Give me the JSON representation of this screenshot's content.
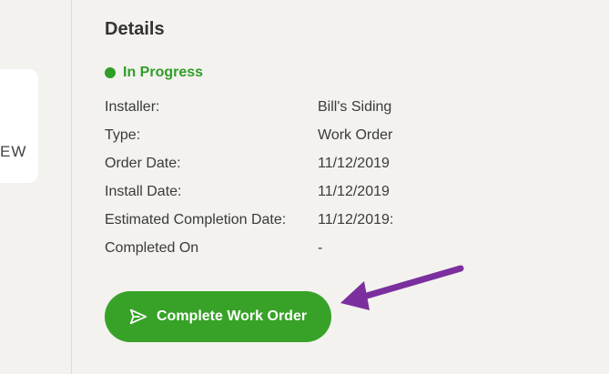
{
  "left_panel": {
    "partial_text": "EW"
  },
  "details": {
    "heading": "Details",
    "status": {
      "label": "In Progress",
      "color": "#2e9e26"
    },
    "rows": [
      {
        "label": "Installer:",
        "value": "Bill's Siding"
      },
      {
        "label": "Type:",
        "value": "Work Order"
      },
      {
        "label": "Order Date:",
        "value": "11/12/2019"
      },
      {
        "label": "Install Date:",
        "value": "11/12/2019"
      },
      {
        "label": "Estimated Completion Date:",
        "value": "11/12/2019:"
      },
      {
        "label": "Completed On",
        "value": "-"
      }
    ]
  },
  "actions": {
    "complete_label": "Complete Work Order",
    "complete_icon": "send-icon",
    "button_color": "#37a227"
  },
  "annotation": {
    "arrow_color": "#7b2f9e"
  }
}
